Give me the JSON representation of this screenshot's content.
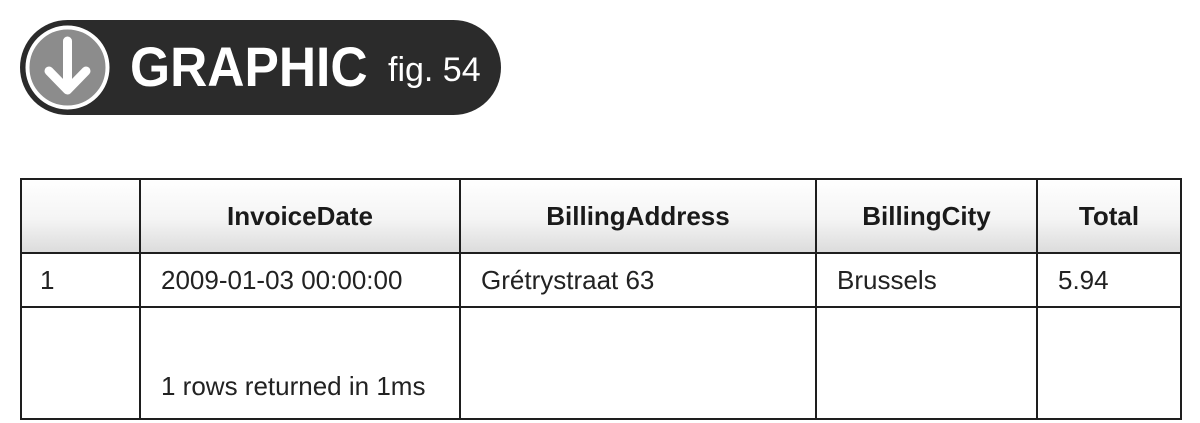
{
  "badge": {
    "title": "GRAPHIC",
    "figure_label": "fig. 54",
    "icon": "arrow-down-circle-icon",
    "background_color": "#2b2b2b",
    "icon_color": "#8c8c8c"
  },
  "table": {
    "headers": [
      "",
      "InvoiceDate",
      "BillingAddress",
      "BillingCity",
      "Total"
    ],
    "rows": [
      [
        "1",
        "2009-01-03  00:00:00",
        "Grétrystraat 63",
        "Brussels",
        "5.94"
      ]
    ],
    "status": "1 rows returned in 1ms"
  }
}
